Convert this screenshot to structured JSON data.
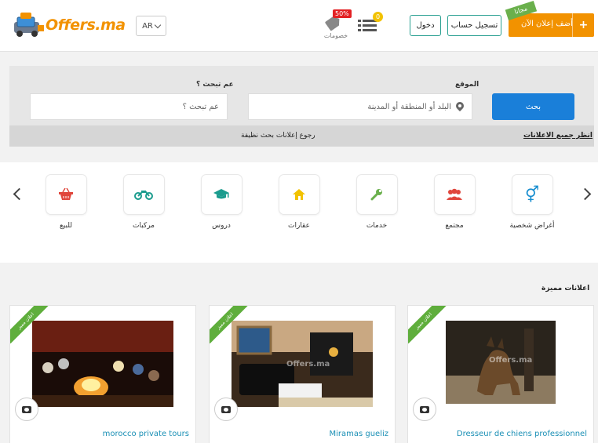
{
  "header": {
    "logo_text": "Offers.ma",
    "lang_label": "AR",
    "promo_badge": "50%",
    "promo_label": "خصومات",
    "list_count": "0",
    "login_label": "دخول",
    "register_label": "تسجيل حساب",
    "post_ad_label": "أضف إعلان الآن",
    "free_ribbon": "مجانا",
    "plus_glyph": "+"
  },
  "search": {
    "location_label": "الموقع",
    "query_label": "عم تبحث ؟",
    "location_placeholder": "البلد أو المنطقة أو المدينة",
    "query_placeholder": "عم تبحث ؟",
    "search_button": "بحث",
    "view_all_ads": "انظر جميع الاعلانات",
    "back_link": "رجوع إعلانات بحث نظيفة"
  },
  "categories": [
    {
      "label": "أغراض شخصية",
      "icon": "gender-icon",
      "glyph": "⚥",
      "color": "#1a8fd0"
    },
    {
      "label": "مجتمع",
      "icon": "people-icon",
      "glyph": "👥",
      "color": "#e0463c"
    },
    {
      "label": "خدمات",
      "icon": "wrench-icon",
      "glyph": "🔧",
      "color": "#6ab04c"
    },
    {
      "label": "عقارات",
      "icon": "house-icon",
      "glyph": "⌂",
      "color": "#f2c200"
    },
    {
      "label": "دروس",
      "icon": "graduation-cap-icon",
      "glyph": "🎓",
      "color": "#1b9c8e"
    },
    {
      "label": "مركبات",
      "icon": "motorcycle-icon",
      "glyph": "🏍",
      "color": "#1b9c8e"
    },
    {
      "label": "للبيع",
      "icon": "basket-icon",
      "glyph": "🧺",
      "color": "#e0463c"
    }
  ],
  "featured": {
    "heading": "اعلانات مميزة",
    "ribbon_label": "اعلان مميز",
    "watermark": "Offers.ma",
    "cards": [
      {
        "title": "Dresseur de chiens professionnel"
      },
      {
        "title": "Miramas gueliz"
      },
      {
        "title": "morocco private tours"
      }
    ]
  }
}
